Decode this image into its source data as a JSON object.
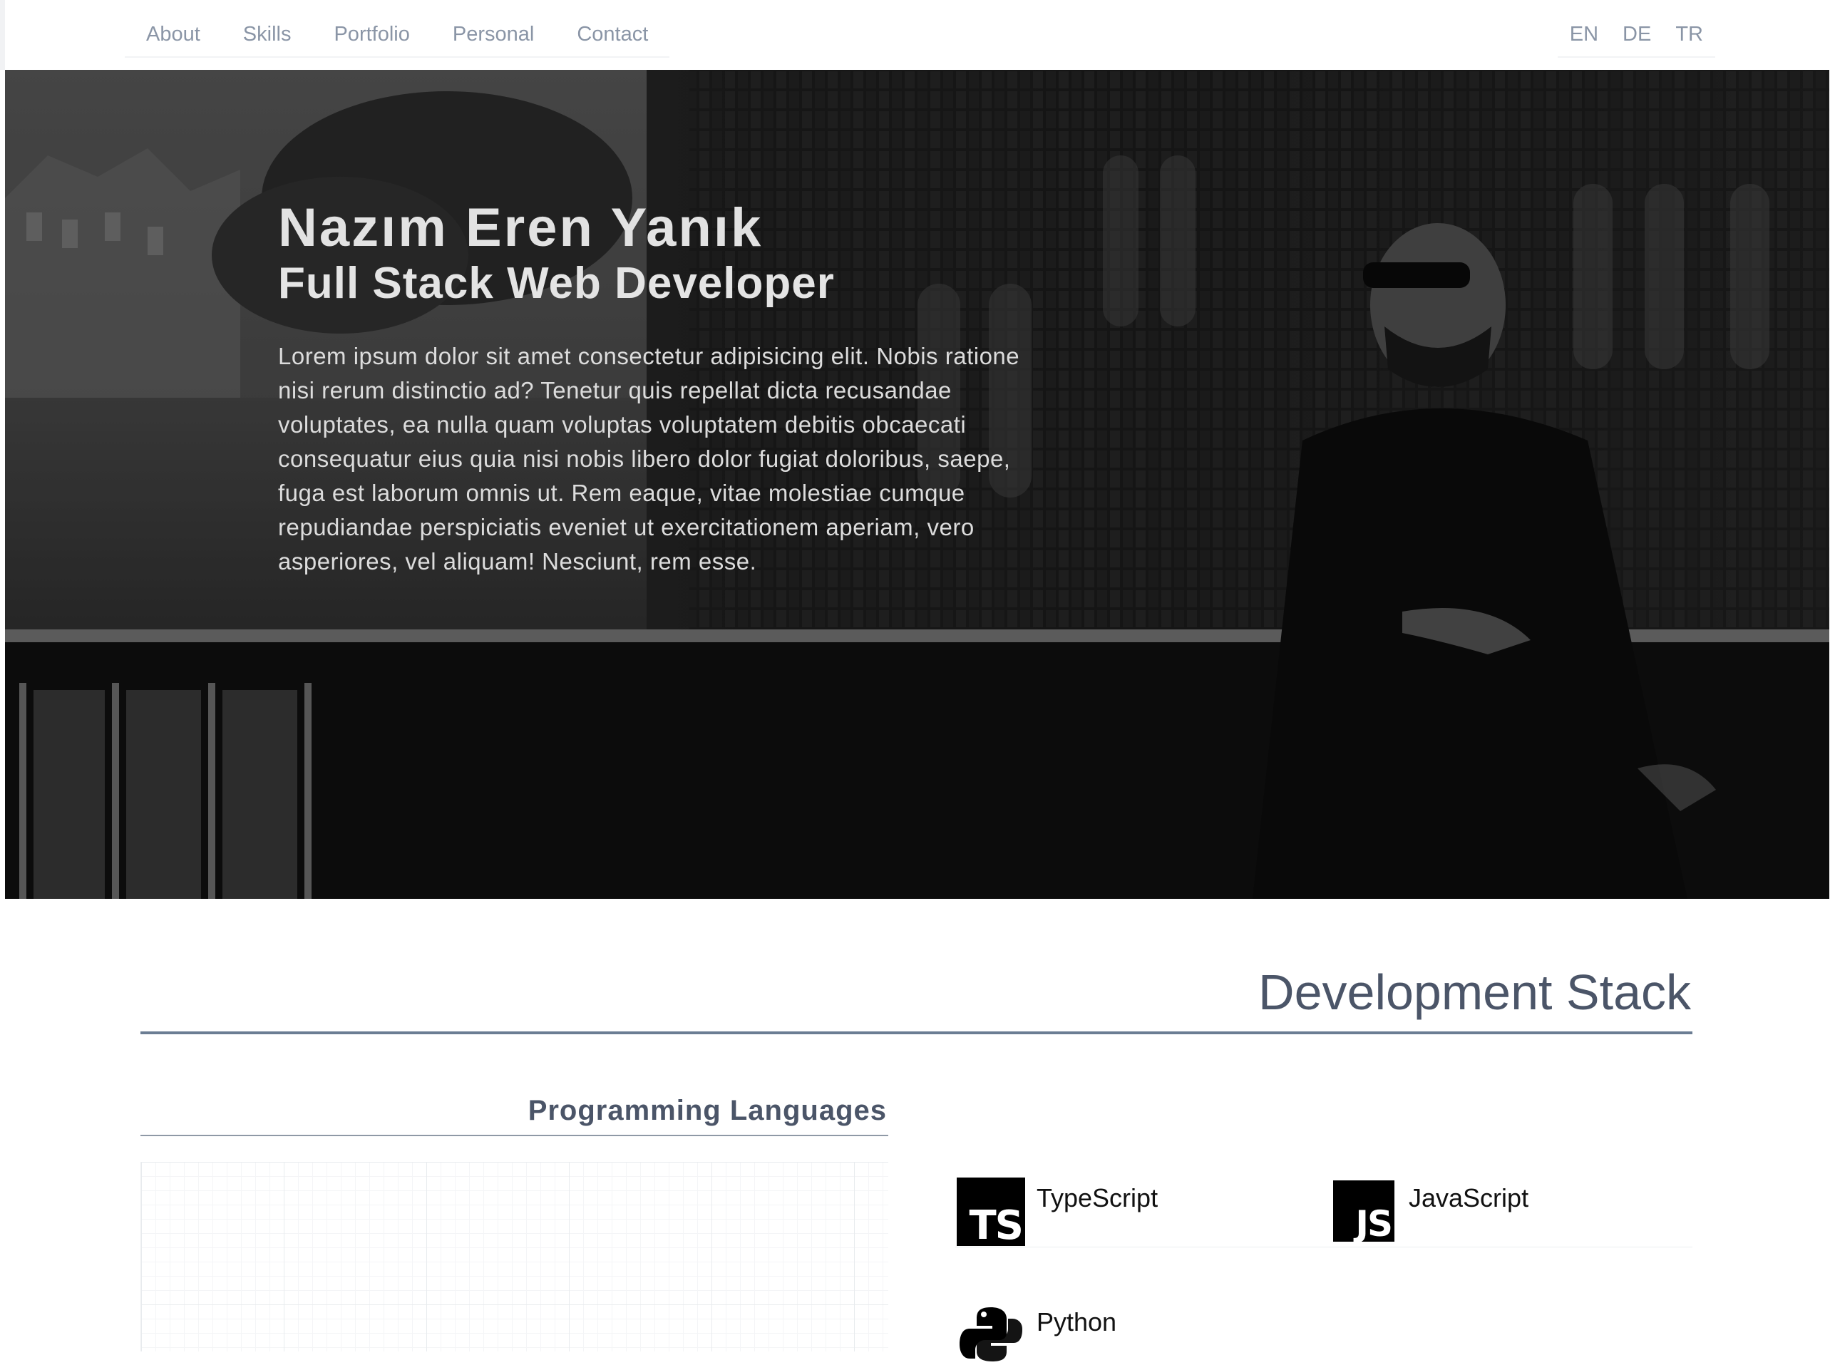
{
  "nav": {
    "links": [
      "About",
      "Skills",
      "Portfolio",
      "Personal",
      "Contact"
    ],
    "languages": [
      "EN",
      "DE",
      "TR"
    ]
  },
  "hero": {
    "name": "Nazım Eren Yanık",
    "role": "Full Stack Web Developer",
    "description": "Lorem ipsum dolor sit amet consectetur adipisicing elit. Nobis ratione nisi rerum distinctio ad? Tenetur quis repellat dicta recusandae voluptates, ea nulla quam voluptas voluptatem debitis obcaecati consequatur eius quia nisi nobis libero dolor fugiat doloribus, saepe, fuga est laborum omnis ut. Rem eaque, vitae molestiae cumque repudiandae perspiciatis eveniet ut exercitationem aperiam, vero asperiores, vel aliquam! Nesciunt, rem esse."
  },
  "stack": {
    "title": "Development Stack",
    "languages_heading": "Programming Languages",
    "skills": [
      {
        "label": "TypeScript",
        "abbr": "TS",
        "icon": "typescript-icon"
      },
      {
        "label": "JavaScript",
        "abbr": "JS",
        "icon": "javascript-icon"
      },
      {
        "label": "Python",
        "abbr": "",
        "icon": "python-icon"
      }
    ]
  },
  "colors": {
    "nav_text": "#8a95a6",
    "heading": "#4b5568",
    "rule": "#6b7d93"
  }
}
